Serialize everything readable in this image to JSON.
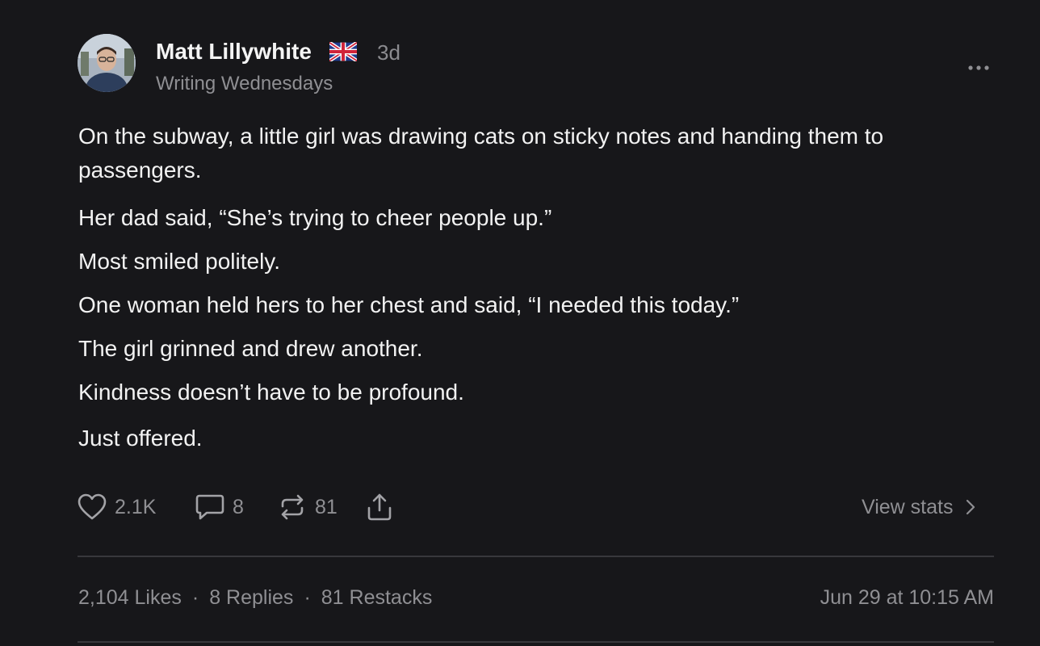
{
  "author": {
    "name": "Matt Lillywhite",
    "flag_icon": "uk-flag-icon",
    "time_ago": "3d",
    "publication": "Writing Wednesdays",
    "avatar_icon": "avatar-photo"
  },
  "menu": {
    "more_icon": "more-horizontal-icon"
  },
  "post": {
    "paragraphs": [
      "On the subway, a little girl was drawing cats on sticky notes and handing them to passengers.",
      "Her dad said, “She’s trying to cheer people up.”",
      "Most smiled politely.",
      "One woman held hers to her chest and said, “I needed this today.”",
      "The girl grinned and drew another.",
      "Kindness doesn’t have to be profound.",
      "Just offered."
    ]
  },
  "actions": {
    "likes": {
      "icon": "heart-icon",
      "count": "2.1K"
    },
    "comments": {
      "icon": "comment-icon",
      "count": "8"
    },
    "restacks": {
      "icon": "restack-icon",
      "count": "81"
    },
    "share": {
      "icon": "share-icon"
    },
    "view_stats_label": "View stats"
  },
  "stats": {
    "likes": "2,104 Likes",
    "separator": "·",
    "replies": "8 Replies",
    "restacks": "81 Restacks",
    "timestamp": "Jun 29 at 10:15 AM"
  },
  "colors": {
    "background": "#17171a",
    "text": "#f2f2f2",
    "muted": "#8f8f93",
    "divider": "#38383c"
  }
}
